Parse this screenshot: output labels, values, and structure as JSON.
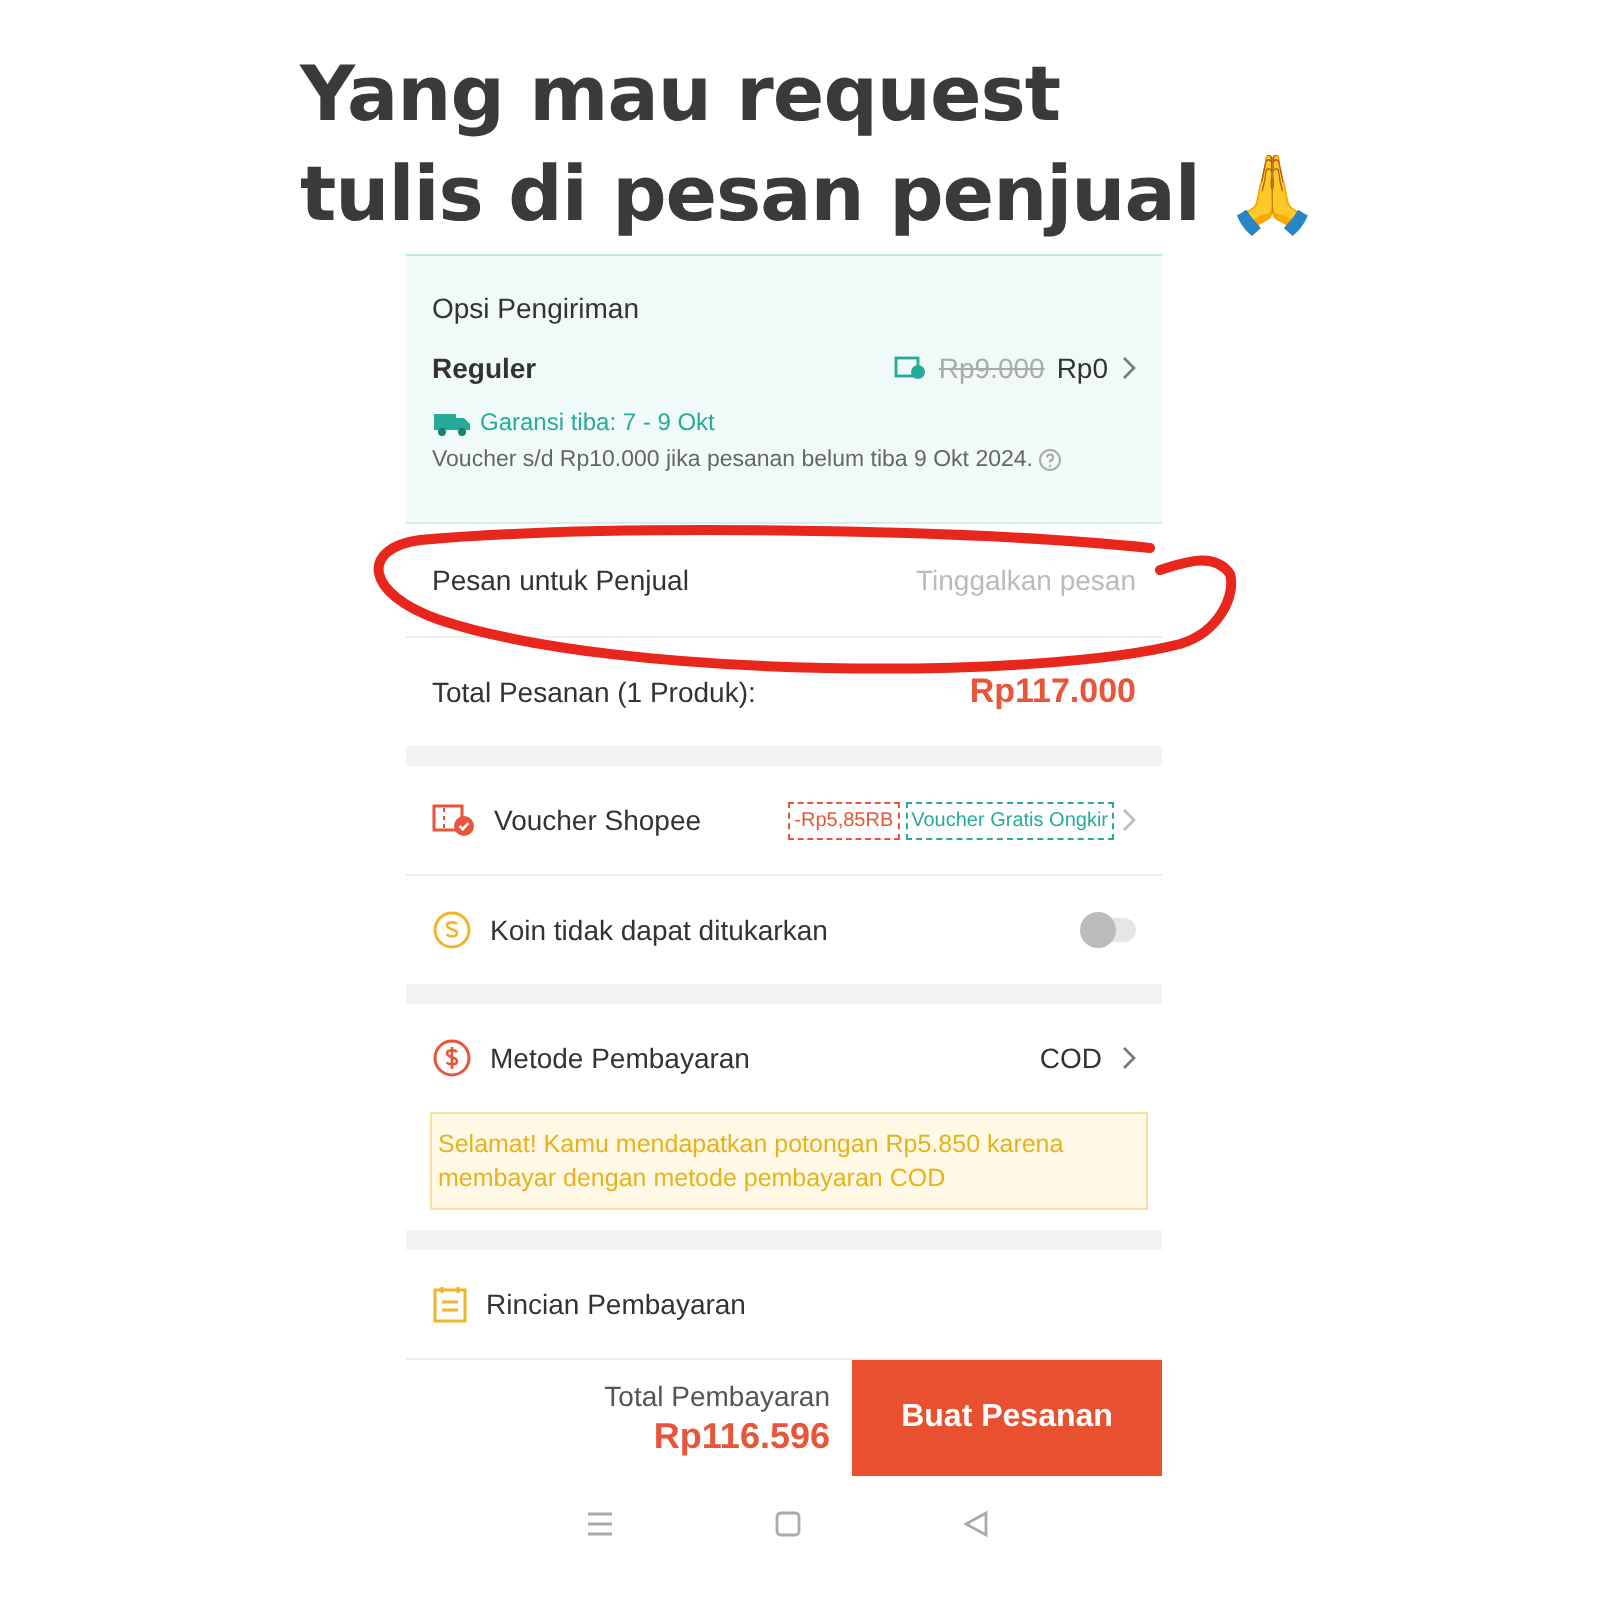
{
  "caption": {
    "lines": [
      "Yang mau request",
      "tulis di pesan penjual 🙏"
    ]
  },
  "shipping": {
    "title": "Opsi Pengiriman",
    "service": "Reguler",
    "old_price": "Rp9.000",
    "price": "Rp0",
    "guarantee": "Garansi tiba: 7 - 9 Okt",
    "note": "Voucher s/d  Rp10.000 jika pesanan belum tiba 9 Okt 2024."
  },
  "seller_message": {
    "label": "Pesan untuk Penjual",
    "placeholder": "Tinggalkan pesan"
  },
  "order_total": {
    "label": "Total Pesanan (1 Produk):",
    "amount": "Rp117.000"
  },
  "voucher": {
    "label": "Voucher Shopee",
    "tags": [
      {
        "text": "-Rp5,85RB",
        "color": "#e8553a"
      },
      {
        "text": "Voucher Gratis Ongkir",
        "color": "#26aa99"
      }
    ]
  },
  "coins": {
    "label": "Koin tidak dapat ditukarkan",
    "on": false
  },
  "payment": {
    "label": "Metode Pembayaran",
    "value": "COD",
    "notice": "Selamat! Kamu mendapatkan potongan Rp5.850 karena membayar dengan metode pembayaran COD"
  },
  "details": {
    "label": "Rincian Pembayaran"
  },
  "footer": {
    "label": "Total Pembayaran",
    "amount": "Rp116.596",
    "button": "Buat Pesanan"
  }
}
